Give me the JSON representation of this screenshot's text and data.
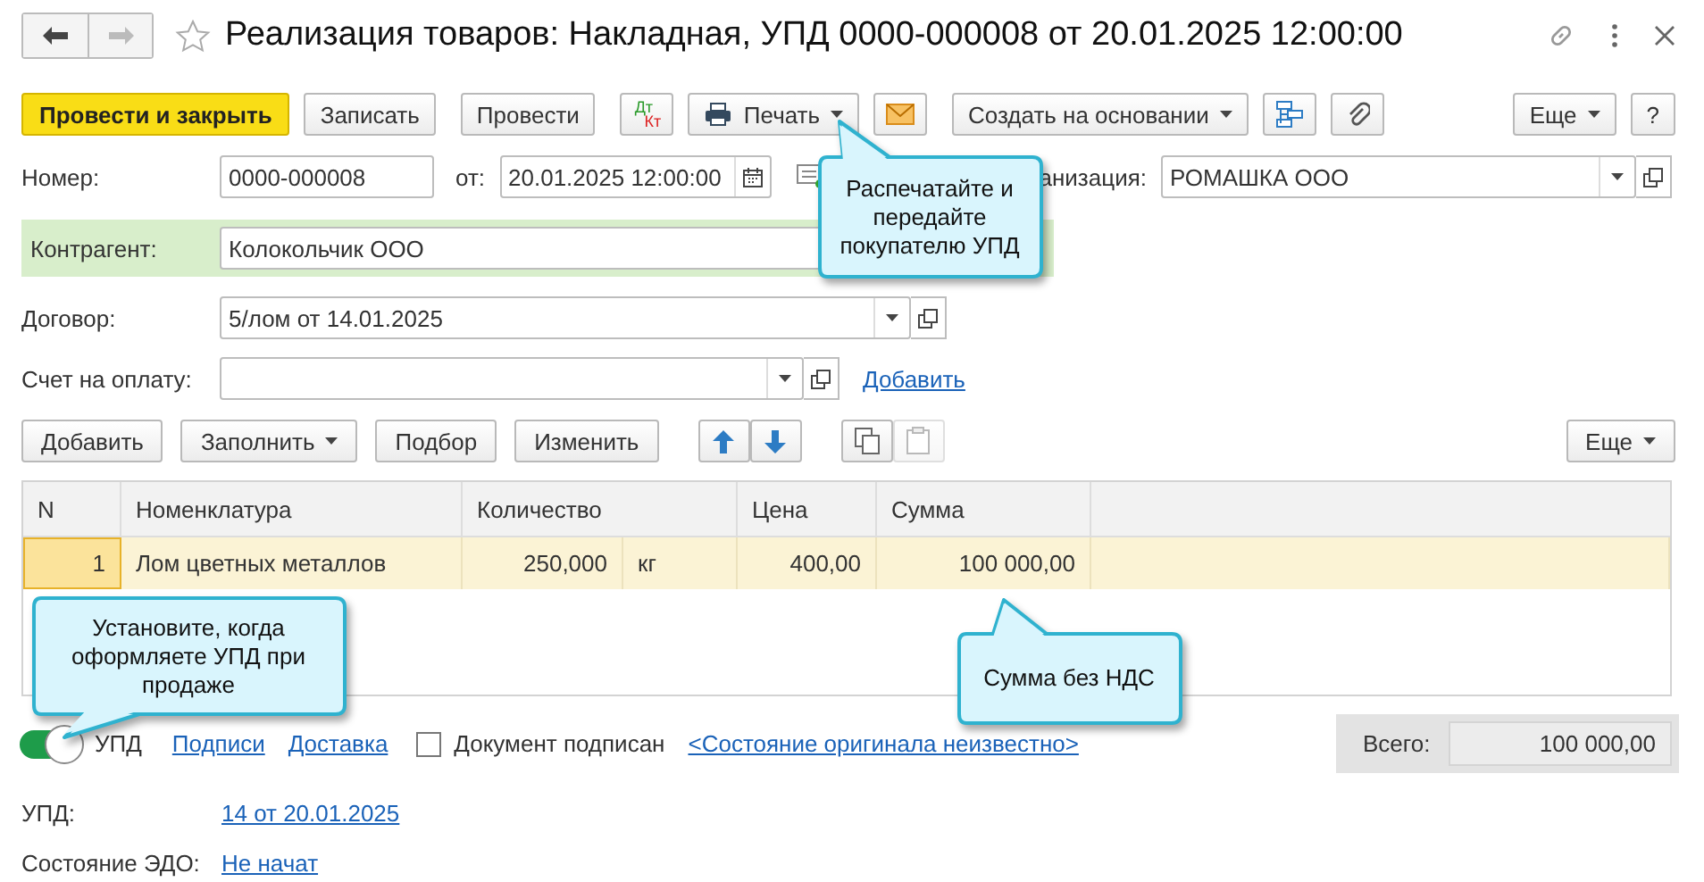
{
  "window": {
    "title": "Реализация товаров: Накладная, УПД 0000-000008 от 20.01.2025 12:00:00"
  },
  "toolbar": [
    [
      {
        "kind": "primary",
        "label": "Провести и закрыть"
      },
      {
        "kind": "plain",
        "label": "Записать"
      }
    ],
    [
      {
        "kind": "plain",
        "label": "Провести"
      }
    ],
    [
      {
        "kind": "dtkt",
        "lines": [
          "Дт",
          "Кт"
        ]
      },
      {
        "kind": "print",
        "label": "Печать",
        "dropdown": true
      },
      {
        "kind": "mail"
      }
    ],
    [
      {
        "kind": "plain",
        "label": "Создать на основании",
        "dropdown": true
      },
      {
        "kind": "structure"
      },
      {
        "kind": "clip"
      }
    ],
    [
      {
        "kind": "plain",
        "label": "Еще",
        "dropdown": true
      },
      {
        "kind": "plain",
        "label": "?"
      }
    ]
  ],
  "number": {
    "label": "Номер:",
    "value": "0000-000008"
  },
  "date": {
    "label": "от:",
    "value": "20.01.2025 12:00:00"
  },
  "organization": {
    "label": "анизация:",
    "value": "РОМАШКА ООО"
  },
  "counterparty": {
    "label": "Контрагент:",
    "value": "Колокольчик ООО",
    "highlighted": true
  },
  "contract": {
    "label": "Договор:",
    "value": "5/лом от 14.01.2025"
  },
  "invoice": {
    "label": "Счет на оплату:",
    "link": "Добавить"
  },
  "table_toolbar": [
    {
      "kind": "plain",
      "label": "Добавить"
    },
    {
      "kind": "plain",
      "label": "Заполнить",
      "dropdown": true
    },
    {
      "kind": "plain",
      "label": "Подбор"
    },
    {
      "kind": "plain",
      "label": "Изменить"
    },
    {
      "kind": "up"
    },
    {
      "kind": "down"
    },
    {
      "kind": "copy"
    },
    {
      "kind": "paste",
      "disabled": true
    },
    {
      "kind": "more",
      "label": "Еще",
      "dropdown": true
    }
  ],
  "table": {
    "columns": [
      "N",
      "Номенклатура",
      "Количество",
      "Цена",
      "Сумма"
    ],
    "rows": [
      {
        "n": "1",
        "item": "Лом цветных металлов",
        "quantity": "250,000",
        "unit": "кг",
        "price": "400,00",
        "sum": "100 000,00",
        "selected": true
      }
    ]
  },
  "upd_toggle": {
    "label": "УПД",
    "on": true
  },
  "links": [
    "Подписи",
    "Доставка"
  ],
  "signed": {
    "label": "Документ подписан",
    "checked": false
  },
  "original_link": "<Состояние оригинала неизвестно>",
  "total": {
    "label": "Всего:",
    "value": "100 000,00"
  },
  "footer": [
    {
      "label": "УПД:",
      "link": "14 от 20.01.2025"
    },
    {
      "label": "Состояние ЭДО:",
      "link": "Не начат"
    }
  ],
  "callouts": [
    {
      "text": "Распечатайте и передайте покупателю УПД"
    },
    {
      "text": "Установите, когда оформляете УПД при продаже"
    },
    {
      "text": "Сумма без НДС"
    }
  ]
}
